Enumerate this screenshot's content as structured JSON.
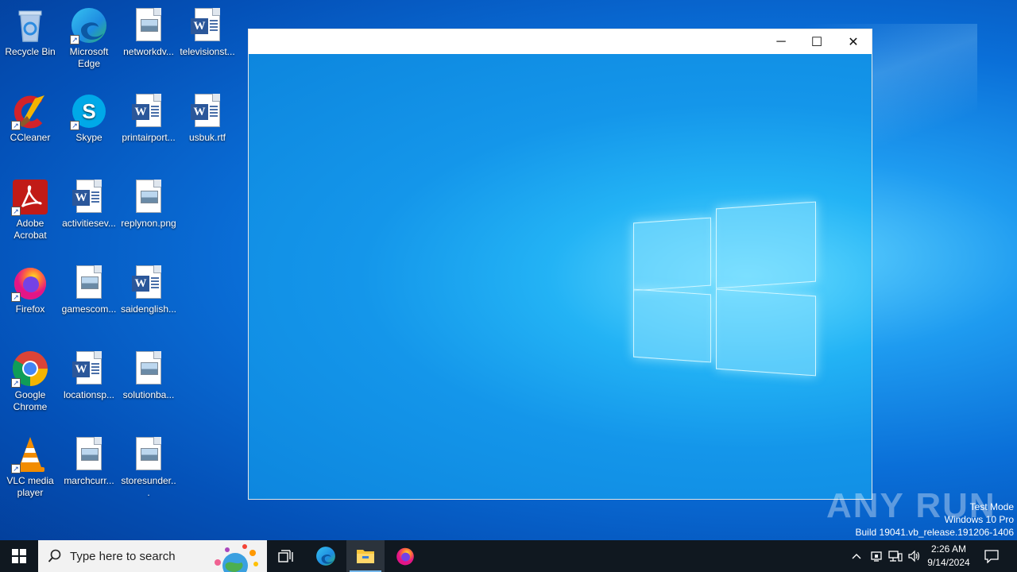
{
  "desktop": {
    "icons": [
      {
        "label": "Recycle Bin",
        "icon": "recycle-bin-icon"
      },
      {
        "label": "Microsoft Edge",
        "icon": "edge-icon"
      },
      {
        "label": "networkdv...",
        "icon": "image-file-icon"
      },
      {
        "label": "televisionst...",
        "icon": "word-doc-icon"
      },
      {
        "label": "CCleaner",
        "icon": "ccleaner-icon"
      },
      {
        "label": "Skype",
        "icon": "skype-icon"
      },
      {
        "label": "printairport...",
        "icon": "word-doc-icon"
      },
      {
        "label": "usbuk.rtf",
        "icon": "word-doc-icon"
      },
      {
        "label": "Adobe Acrobat",
        "icon": "acrobat-icon"
      },
      {
        "label": "activitiesev...",
        "icon": "word-doc-icon"
      },
      {
        "label": "replynon.png",
        "icon": "image-file-icon"
      },
      {
        "label": "Firefox",
        "icon": "firefox-icon"
      },
      {
        "label": "gamescom...",
        "icon": "image-file-icon"
      },
      {
        "label": "saidenglish...",
        "icon": "word-doc-icon"
      },
      {
        "label": "Google Chrome",
        "icon": "chrome-icon"
      },
      {
        "label": "locationsp...",
        "icon": "word-doc-icon"
      },
      {
        "label": "solutionba...",
        "icon": "image-file-icon"
      },
      {
        "label": "VLC media player",
        "icon": "vlc-icon"
      },
      {
        "label": "marchcurr...",
        "icon": "image-file-icon"
      },
      {
        "label": "storesunder...",
        "icon": "image-file-icon"
      }
    ]
  },
  "window": {
    "minimize": "─",
    "maximize": "☐",
    "close": "✕"
  },
  "watermark": {
    "brand": "ANY RUN",
    "line1": "Test Mode",
    "line2": "Windows 10 Pro",
    "line3": "Build 19041.vb_release.191206-1406"
  },
  "taskbar": {
    "search_placeholder": "Type here to search",
    "time": "2:26 AM",
    "date": "9/14/2024",
    "pinned": [
      "task-view-icon",
      "edge-icon",
      "file-explorer-icon",
      "firefox-icon"
    ],
    "tray_chevron": "^"
  },
  "colors": {
    "taskbar_bg": "#101820",
    "accent": "#0a6fd8"
  }
}
